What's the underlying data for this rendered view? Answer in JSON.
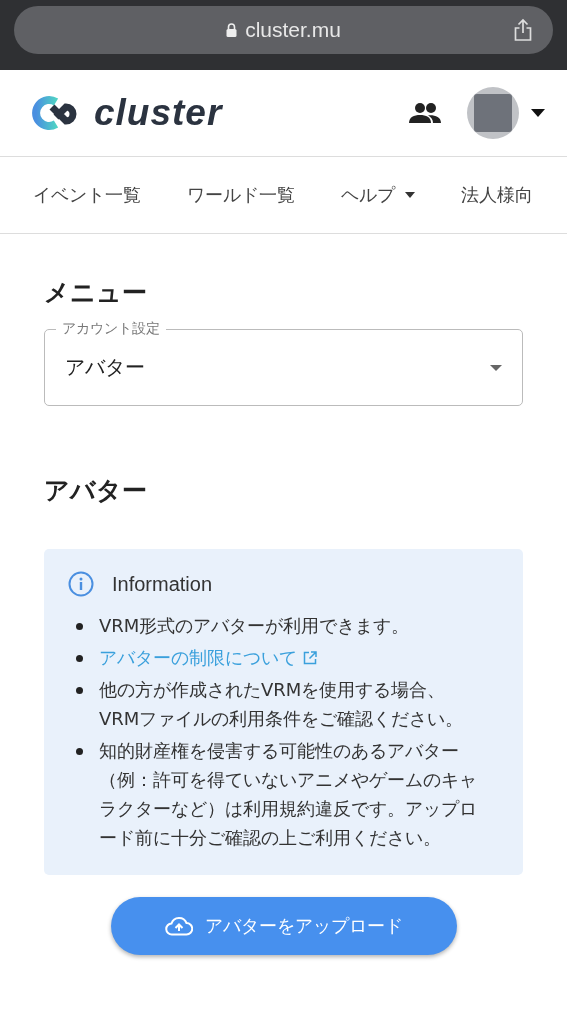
{
  "browser": {
    "url": "cluster.mu"
  },
  "header": {
    "logo_text": "cluster"
  },
  "nav": [
    {
      "label": "イベント一覧",
      "dropdown": false
    },
    {
      "label": "ワールド一覧",
      "dropdown": false
    },
    {
      "label": "ヘルプ",
      "dropdown": true
    },
    {
      "label": "法人様向",
      "dropdown": false
    }
  ],
  "menu": {
    "heading": "メニュー",
    "select": {
      "label": "アカウント設定",
      "value": "アバター"
    }
  },
  "section": {
    "title": "アバター"
  },
  "info": {
    "title": "Information",
    "items": [
      {
        "kind": "text",
        "text": "VRM形式のアバターが利用できます。"
      },
      {
        "kind": "link",
        "text": "アバターの制限について"
      },
      {
        "kind": "text",
        "text": "他の方が作成されたVRMを使用する場合、VRMファイルの利用条件をご確認ください。"
      },
      {
        "kind": "text",
        "text": "知的財産権を侵害する可能性のあるアバター（例：許可を得ていないアニメやゲームのキャラクターなど）は利用規約違反です。アップロード前に十分ご確認の上ご利用ください。"
      }
    ]
  },
  "upload_button": "アバターをアップロード"
}
